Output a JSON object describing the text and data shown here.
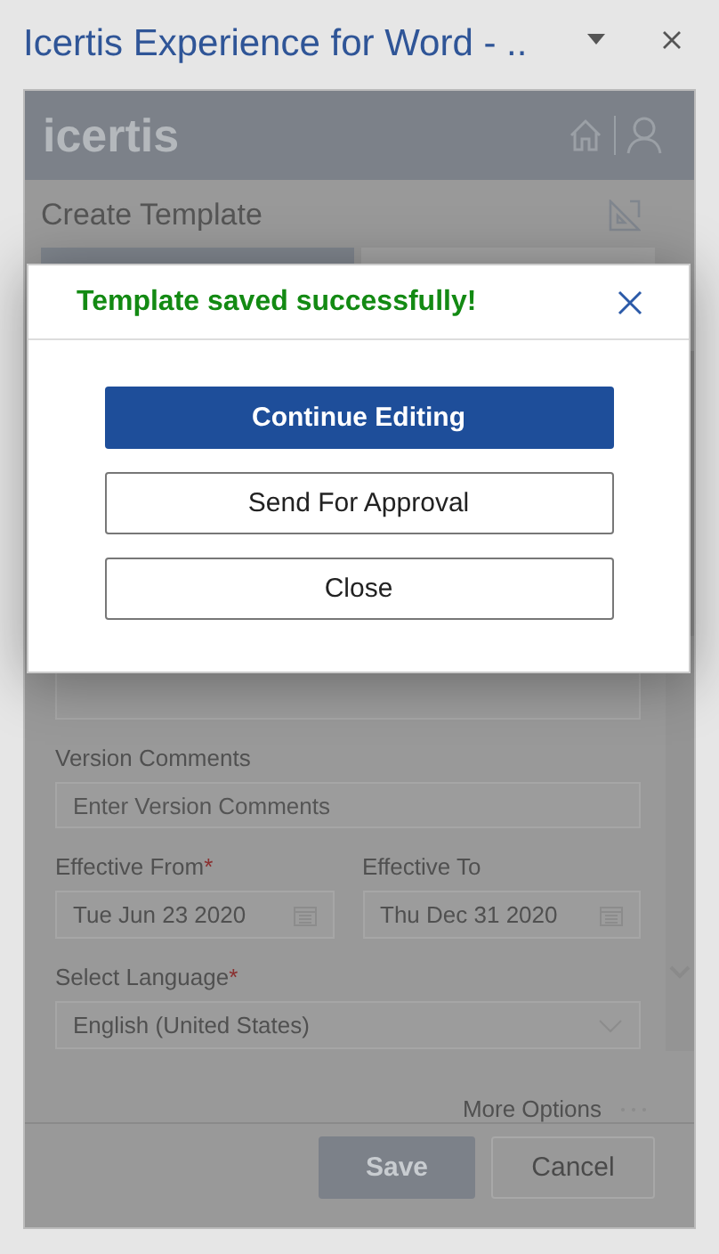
{
  "window": {
    "title": "Icertis Experience for Word - .."
  },
  "header": {
    "logo": "icertis"
  },
  "page": {
    "title": "Create Template"
  },
  "form": {
    "fields": [
      {
        "kind": "text",
        "label": "Version Comments",
        "placeholder": "Enter Version Comments"
      },
      {
        "kind": "dates",
        "items": [
          {
            "label": "Effective From",
            "required_mark": "*",
            "value": "Tue Jun 23 2020"
          },
          {
            "label": "Effective To",
            "value": "Thu Dec 31 2020"
          }
        ]
      },
      {
        "kind": "select",
        "label": "Select Language",
        "required_mark": "*",
        "value": "English (United States)"
      }
    ]
  },
  "more_options": "More Options",
  "footer": {
    "buttons": [
      {
        "label": "Save",
        "kind": "primary"
      },
      {
        "label": "Cancel",
        "kind": "secondary"
      }
    ]
  },
  "dialog": {
    "title": "Template saved successfully!",
    "buttons": [
      {
        "label": "Continue Editing",
        "kind": "primary"
      },
      {
        "label": "Send For Approval",
        "kind": "secondary"
      },
      {
        "label": "Close",
        "kind": "secondary"
      }
    ]
  }
}
